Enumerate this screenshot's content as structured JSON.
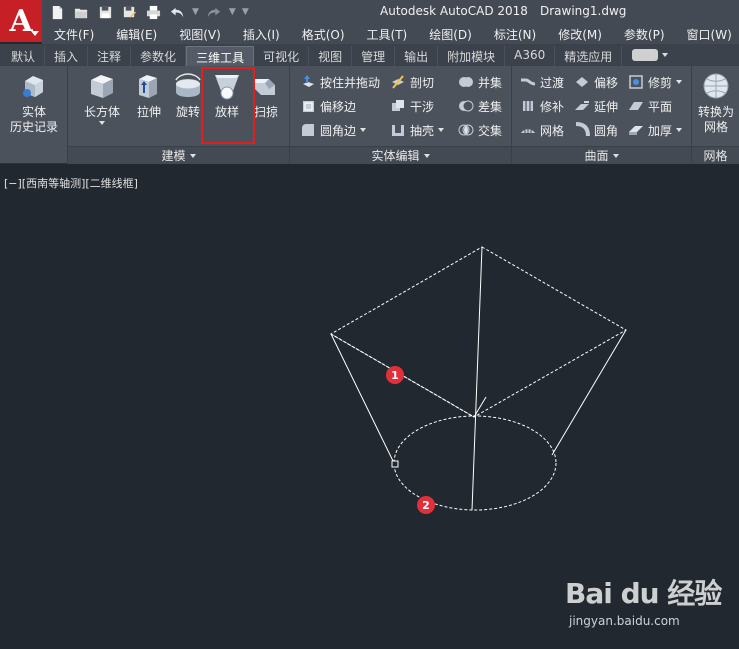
{
  "app": {
    "logo_letter": "A",
    "title": "Autodesk AutoCAD 2018",
    "document": "Drawing1.dwg"
  },
  "menubar": [
    "文件(F)",
    "编辑(E)",
    "视图(V)",
    "插入(I)",
    "格式(O)",
    "工具(T)",
    "绘图(D)",
    "标注(N)",
    "修改(M)",
    "参数(P)",
    "窗口(W)"
  ],
  "ribbon_tabs": [
    {
      "label": "默认",
      "active": false
    },
    {
      "label": "插入",
      "active": false
    },
    {
      "label": "注释",
      "active": false
    },
    {
      "label": "参数化",
      "active": false
    },
    {
      "label": "三维工具",
      "active": true
    },
    {
      "label": "可视化",
      "active": false
    },
    {
      "label": "视图",
      "active": false
    },
    {
      "label": "管理",
      "active": false
    },
    {
      "label": "输出",
      "active": false
    },
    {
      "label": "附加模块",
      "active": false
    },
    {
      "label": "A360",
      "active": false
    },
    {
      "label": "精选应用",
      "active": false
    }
  ],
  "panels": {
    "history": {
      "label_line1": "实体",
      "label_line2": "历史记录"
    },
    "modeling": {
      "title": "建模",
      "box": "长方体",
      "extrude": "拉伸",
      "revolve": "旋转",
      "loft": "放样",
      "sweep": "扫掠"
    },
    "solid_edit": {
      "title": "实体编辑",
      "presspull": "按住并拖动",
      "offset_edge": "偏移边",
      "fillet_edge": "圆角边",
      "slice": "剖切",
      "interfere": "干涉",
      "shell": "抽壳",
      "union": "并集",
      "subtract": "差集",
      "intersect": "交集"
    },
    "surface": {
      "title": "曲面",
      "blend": "过渡",
      "patch": "修补",
      "network": "网格",
      "offset": "偏移",
      "extend": "延伸",
      "fillet": "圆角",
      "trim": "修剪",
      "planar": "平面",
      "thicken": "加厚"
    },
    "mesh": {
      "title": "网格",
      "convert_line1": "转换为",
      "convert_line2": "网格"
    }
  },
  "viewport": {
    "label": "[−][西南等轴测][二维线框]"
  },
  "markers": [
    "1",
    "2"
  ],
  "watermark": {
    "logo": "Bai du 经验",
    "url": "jingyan.baidu.com"
  },
  "colors": {
    "accent_red": "#c62026",
    "highlight_box": "#e02020",
    "marker": "#e0303a",
    "canvas": "#212830"
  }
}
